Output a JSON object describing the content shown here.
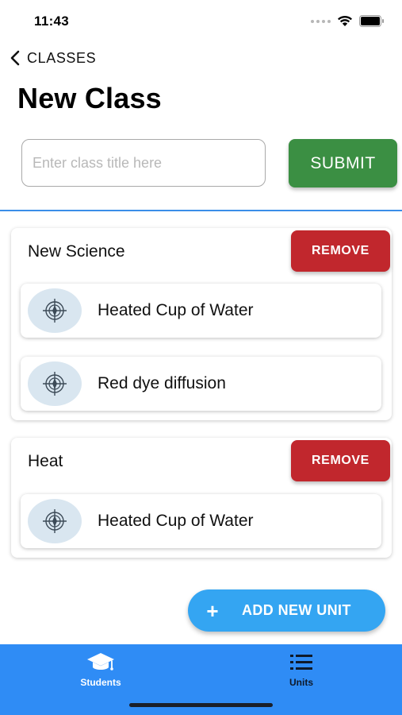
{
  "status": {
    "time": "11:43"
  },
  "nav": {
    "back_label": "CLASSES"
  },
  "page": {
    "title": "New Class"
  },
  "form": {
    "placeholder": "Enter class title here",
    "value": "",
    "submit_label": "SUBMIT"
  },
  "classes": [
    {
      "title": "New Science",
      "remove_label": "REMOVE",
      "units": [
        {
          "label": "Heated Cup of Water",
          "icon": "compass-icon"
        },
        {
          "label": "Red dye diffusion",
          "icon": "compass-icon"
        }
      ]
    },
    {
      "title": "Heat",
      "remove_label": "REMOVE",
      "units": [
        {
          "label": "Heated Cup of Water",
          "icon": "compass-icon"
        }
      ]
    }
  ],
  "add_unit": {
    "label": "ADD NEW UNIT",
    "icon": "plus-icon"
  },
  "tabs": [
    {
      "label": "Students",
      "icon": "graduation-cap-icon",
      "active": true
    },
    {
      "label": "Units",
      "icon": "list-icon",
      "active": false
    }
  ],
  "colors": {
    "submit": "#3b8f43",
    "remove": "#c1272d",
    "add_unit": "#34a5f2",
    "tab_bar": "#2f8cf5",
    "divider": "#3a8ee8",
    "unit_icon_bg": "#d9e6f0"
  }
}
